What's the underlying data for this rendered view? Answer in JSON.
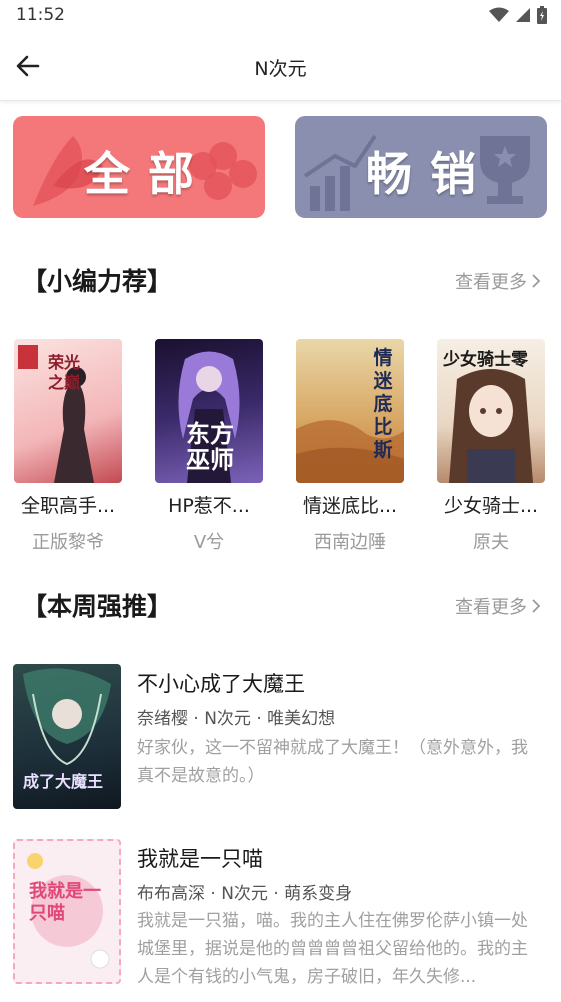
{
  "status": {
    "time": "11:52"
  },
  "header": {
    "title": "N次元"
  },
  "banners": {
    "all": "全部",
    "bestseller": "畅销"
  },
  "section1": {
    "title": "【小编力荐】",
    "more": "查看更多"
  },
  "section2": {
    "title": "【本周强推】",
    "more": "查看更多"
  },
  "recommended": [
    {
      "name": "全职高手...",
      "author": "正版黎爷",
      "cover_text": "荣光之巅"
    },
    {
      "name": "HP惹不...",
      "author": "V兮",
      "cover_text": "东方巫师"
    },
    {
      "name": "情迷底比...",
      "author": "西南边陲",
      "cover_text": "情迷底比斯"
    },
    {
      "name": "少女骑士...",
      "author": "原夫",
      "cover_text": "少女骑士零"
    }
  ],
  "weekly": [
    {
      "title": "不小心成了大魔王",
      "meta": "奈绪樱 · N次元 · 唯美幻想",
      "desc": "好家伙，这一不留神就成了大魔王！（意外意外，我真不是故意的。）",
      "cover_text": "成了大魔王"
    },
    {
      "title": "我就是一只喵",
      "meta": "布布高深 · N次元 · 萌系变身",
      "desc": "我就是一只猫，喵。我的主人住在佛罗伦萨小镇一处城堡里，据说是他的曾曾曾曾祖父留给他的。我的主人是个有钱的小气鬼，房子破旧，年久失修...",
      "cover_text": "我就是一只喵"
    }
  ],
  "colors": {
    "banner_all": "#f4787a",
    "banner_best": "#8a8fb0"
  }
}
